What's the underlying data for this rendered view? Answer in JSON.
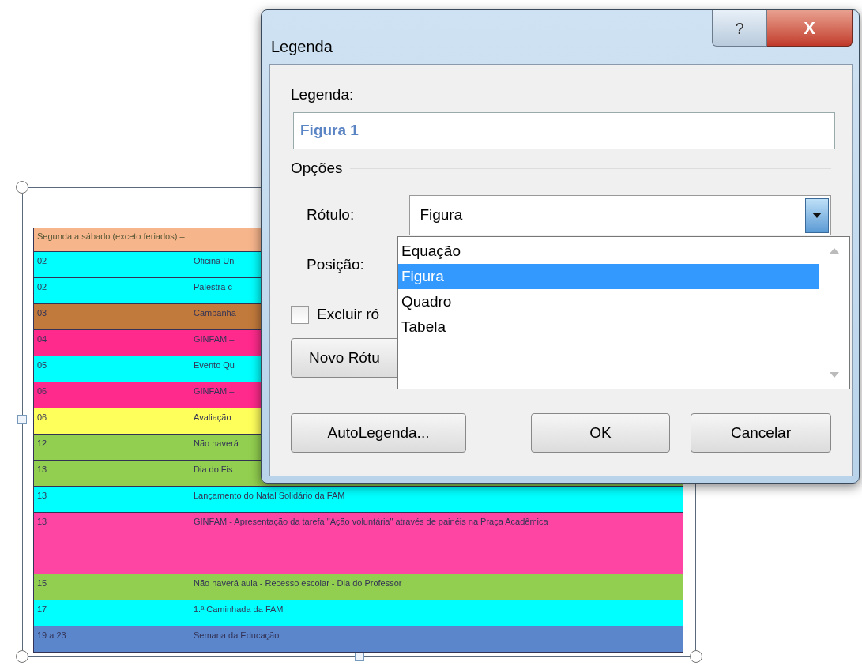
{
  "document_table": {
    "header": "Segunda a sábado (exceto feriados) –",
    "rows": [
      {
        "date": "02",
        "event": "Oficina Un",
        "color": "#00ffff",
        "tall": false
      },
      {
        "date": "02",
        "event": "Palestra c",
        "color": "#00ffff",
        "tall": false
      },
      {
        "date": "03",
        "event": "Campanha",
        "color": "#c27a3c",
        "tall": false
      },
      {
        "date": "04",
        "event": "GINFAM –",
        "color": "#ff2a8c",
        "tall": false
      },
      {
        "date": "05",
        "event": "Evento Qu",
        "color": "#00ffff",
        "tall": false
      },
      {
        "date": "06",
        "event": "GINFAM –",
        "color": "#ff2a8c",
        "tall": false
      },
      {
        "date": "06",
        "event": "Avaliação",
        "color": "#ffff5c",
        "tall": false
      },
      {
        "date": "12",
        "event": "Não haverá",
        "color": "#92cf50",
        "tall": false
      },
      {
        "date": "13",
        "event": "Dia do Fis",
        "color": "#92cf50",
        "tall": false
      },
      {
        "date": "13",
        "event": "Lançamento do Natal Solidário da FAM",
        "color": "#00ffff",
        "tall": false
      },
      {
        "date": "13",
        "event": "GINFAM - Apresentação da tarefa \"Ação voluntária\" através de painéis na Praça Acadêmica",
        "color": "#ff45a3",
        "tall": true
      },
      {
        "date": "15",
        "event": "Não haverá aula - Recesso escolar - Dia do Professor",
        "color": "#92cf50",
        "tall": false
      },
      {
        "date": "17",
        "event": "1.ª Caminhada da FAM",
        "color": "#00ffff",
        "tall": false
      },
      {
        "date": "19 a 23",
        "event": "Semana da Educação",
        "color": "#5b86cc",
        "tall": false
      }
    ]
  },
  "dialog": {
    "title": "Legenda",
    "help_button": "?",
    "close_button": "X",
    "caption_label": "Legenda:",
    "caption_value": "Figura 1",
    "options_heading": "Opções",
    "label_label": "Rótulo:",
    "label_value": "Figura",
    "position_label": "Posição:",
    "exclude_checkbox": {
      "label": "Excluir ró",
      "checked": false
    },
    "new_label_button": "Novo Rótu",
    "label_options": [
      {
        "text": "Equação",
        "selected": false
      },
      {
        "text": "Figura",
        "selected": true
      },
      {
        "text": "Quadro",
        "selected": false
      },
      {
        "text": "Tabela",
        "selected": false
      }
    ],
    "buttons": [
      "AutoLegenda...",
      "OK",
      "Cancelar"
    ]
  }
}
